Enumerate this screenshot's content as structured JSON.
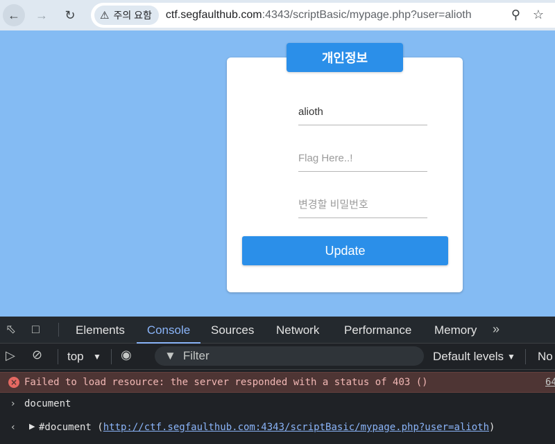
{
  "browser": {
    "security_label": "주의 요함",
    "url_host": "ctf.segfaulthub.com",
    "url_rest": ":4343/scriptBasic/mypage.php?user=alioth"
  },
  "card": {
    "title": "개인정보",
    "user_value": "alioth",
    "flag_placeholder": "Flag Here..!",
    "password_placeholder": "변경할 비밀번호",
    "update_label": "Update"
  },
  "devtools": {
    "tabs": [
      "Elements",
      "Console",
      "Sources",
      "Network",
      "Performance",
      "Memory"
    ],
    "active_tab": "Console",
    "context": "top",
    "filter_placeholder": "Filter",
    "levels": "Default levels",
    "truncated_right": "No",
    "console": {
      "error_message": "Failed to load resource: the server responded with a status of 403 ()",
      "error_source": "64",
      "input": "document",
      "result_prefix": "#document (",
      "result_url": "http://ctf.segfaulthub.com:4343/scriptBasic/mypage.php?user=alioth",
      "result_suffix": ")"
    }
  },
  "icons": {
    "back": "back-arrow-icon",
    "forward": "forward-arrow-icon",
    "reload": "reload-icon",
    "warning": "warning-icon",
    "zoom": "zoom-icon",
    "star": "star-icon"
  },
  "colors": {
    "page_background": "#84bbf3",
    "accent": "#2b8fe9",
    "devtools_background": "#1f2226",
    "error_row": "#4e3534"
  }
}
